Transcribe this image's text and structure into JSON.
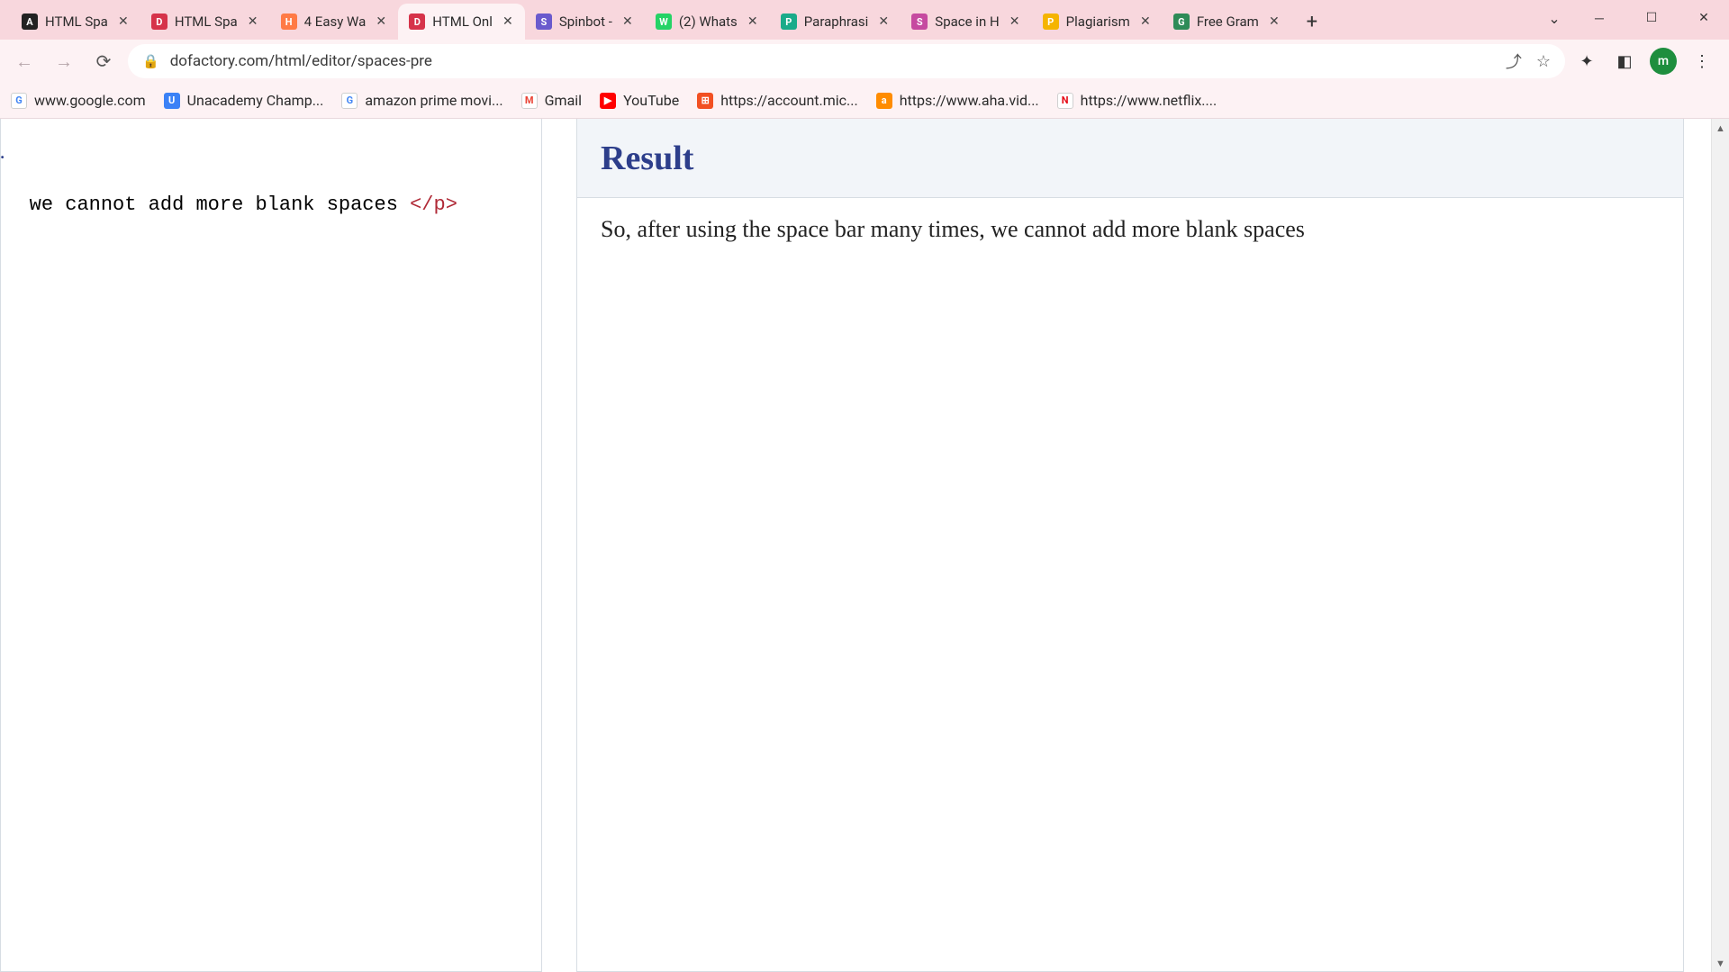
{
  "window": {
    "url": "dofactory.com/html/editor/spaces-pre"
  },
  "tabs": [
    {
      "label": "HTML Spa",
      "favbg": "#222222",
      "favtxt": "A",
      "active": false
    },
    {
      "label": "HTML Spa",
      "favbg": "#d6334a",
      "favtxt": "D",
      "active": false
    },
    {
      "label": "4 Easy Wa",
      "favbg": "#ff7a45",
      "favtxt": "H",
      "active": false
    },
    {
      "label": "HTML Onl",
      "favbg": "#d6334a",
      "favtxt": "D",
      "active": true
    },
    {
      "label": "Spinbot -",
      "favbg": "#6a5acd",
      "favtxt": "S",
      "active": false
    },
    {
      "label": "(2) Whats",
      "favbg": "#25d366",
      "favtxt": "W",
      "active": false
    },
    {
      "label": "Paraphrasi",
      "favbg": "#1aab8a",
      "favtxt": "P",
      "active": false
    },
    {
      "label": "Space in H",
      "favbg": "#c64aa0",
      "favtxt": "S",
      "active": false
    },
    {
      "label": "Plagiarism",
      "favbg": "#f5b400",
      "favtxt": "P",
      "active": false
    },
    {
      "label": "Free Gram",
      "favbg": "#2e8b57",
      "favtxt": "G",
      "active": false
    }
  ],
  "bookmarks": [
    {
      "label": "www.google.com",
      "favbg": "#ffffff",
      "favborder": "#d0d0d0",
      "favtxt": "G",
      "favcolor": "#4285f4"
    },
    {
      "label": "Unacademy Champ...",
      "favbg": "#3b82f6",
      "favtxt": "U",
      "favcolor": "#fff"
    },
    {
      "label": "amazon prime movi...",
      "favbg": "#ffffff",
      "favborder": "#d0d0d0",
      "favtxt": "G",
      "favcolor": "#4285f4"
    },
    {
      "label": "Gmail",
      "favbg": "#ffffff",
      "favborder": "#d0d0d0",
      "favtxt": "M",
      "favcolor": "#ea4335"
    },
    {
      "label": "YouTube",
      "favbg": "#ff0000",
      "favtxt": "▶",
      "favcolor": "#fff"
    },
    {
      "label": "https://account.mic...",
      "favbg": "#f25022",
      "favtxt": "⊞",
      "favcolor": "#fff"
    },
    {
      "label": "https://www.aha.vid...",
      "favbg": "#ff8c00",
      "favtxt": "a",
      "favcolor": "#fff"
    },
    {
      "label": "https://www.netflix....",
      "favbg": "#ffffff",
      "favborder": "#d0d0d0",
      "favtxt": "N",
      "favcolor": "#e50914"
    }
  ],
  "editor": {
    "line1_suffix": "nt.",
    "code_text": " we cannot add more blank spaces ",
    "closing_tag": "</p>"
  },
  "result": {
    "heading": "Result",
    "text": "So, after using the space bar many times, we cannot add more blank spaces"
  },
  "profile_initial": "m"
}
